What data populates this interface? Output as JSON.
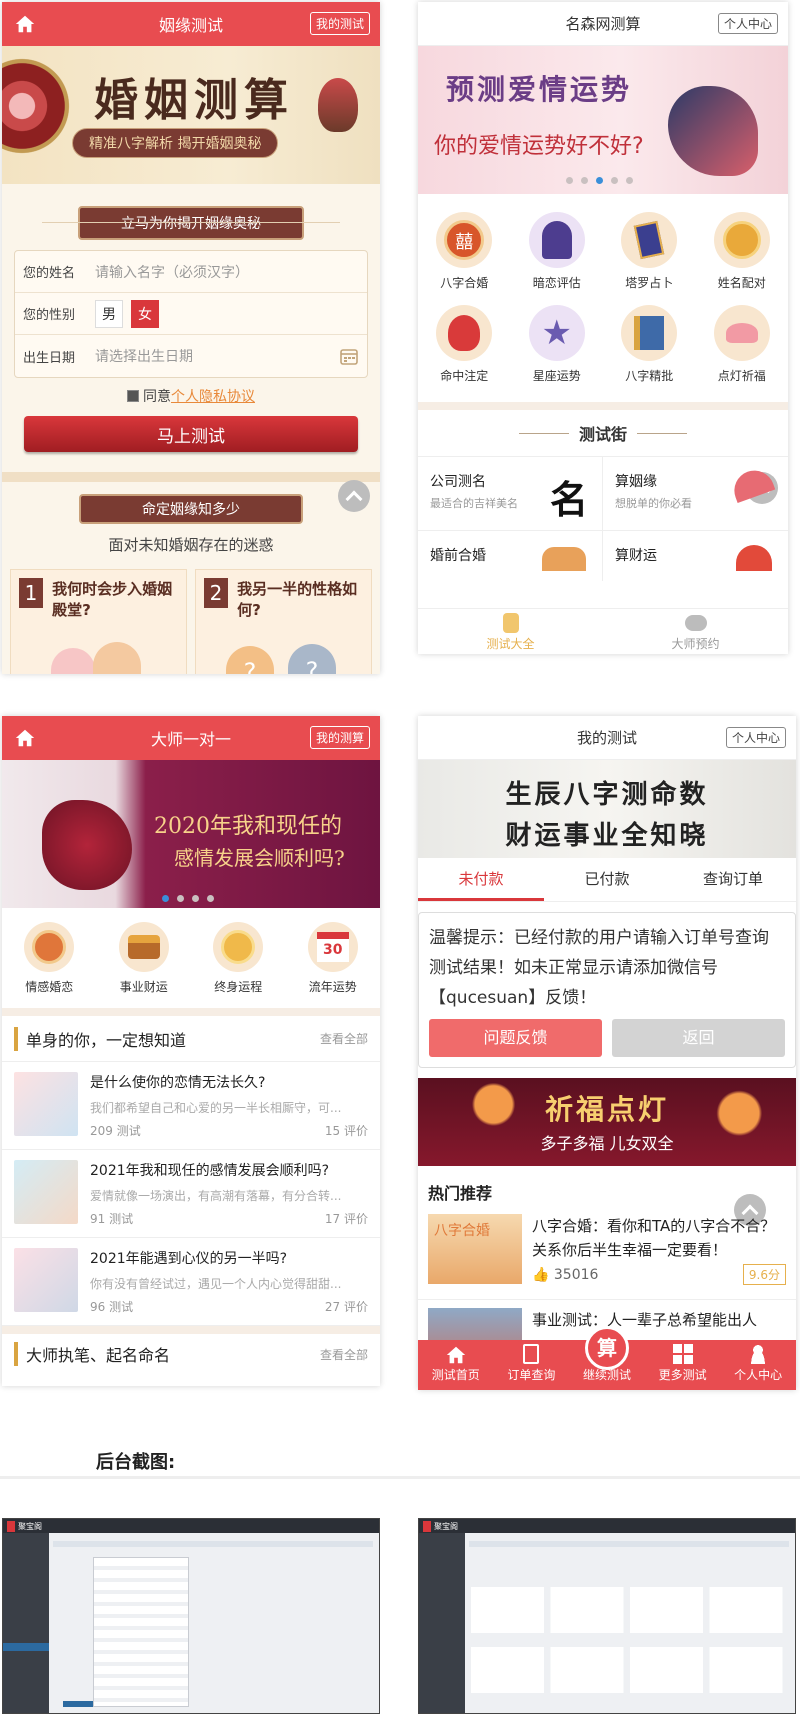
{
  "p1": {
    "title": "姻缘测试",
    "my_btn": "我的测试",
    "banner_title": "婚姻测算",
    "banner_sub": "精准八字解析  揭开婚姻奥秘",
    "ribbon": "立马为你揭开姻缘奥秘",
    "form": {
      "name_label": "您的姓名",
      "name_placeholder": "请输入名字（必须汉字）",
      "sex_label": "您的性别",
      "male": "男",
      "female": "女",
      "birth_label": "出生日期",
      "birth_placeholder": "请选择出生日期"
    },
    "agree_prefix": "同意",
    "agree_link": "个人隐私协议",
    "submit": "马上测试",
    "ribbon2": "命定姻缘知多少",
    "tagline": "面对未知婚姻存在的迷惑",
    "cards": [
      {
        "num": "1",
        "text": "我何时会步入婚姻殿堂?"
      },
      {
        "num": "2",
        "text": "我另一半的性格如何?"
      }
    ]
  },
  "p2": {
    "title": "名森网测算",
    "center_btn": "个人中心",
    "banner_title": "预测爱情运势",
    "banner_sub": "你的爱情运势好不好?",
    "icons": [
      {
        "label": "八字合婚",
        "icon": "double-happiness-icon"
      },
      {
        "label": "暗恋评估",
        "icon": "crush-icon"
      },
      {
        "label": "塔罗占卜",
        "icon": "tarot-icon"
      },
      {
        "label": "姓名配对",
        "icon": "coin-icon"
      },
      {
        "label": "命中注定",
        "icon": "fate-doll-icon"
      },
      {
        "label": "星座运势",
        "icon": "star-icon"
      },
      {
        "label": "八字精批",
        "icon": "book-icon"
      },
      {
        "label": "点灯祈福",
        "icon": "lantern-icon"
      }
    ],
    "section": "测试街",
    "street": [
      {
        "title": "公司测名",
        "sub": "最适合的吉祥美名"
      },
      {
        "title": "算姻缘",
        "sub": "想脱单的你必看"
      },
      {
        "title": "婚前合婚",
        "sub": ""
      },
      {
        "title": "算财运",
        "sub": ""
      }
    ],
    "tabs": [
      "测试大全",
      "大师预约"
    ],
    "colors": {
      "accent": "#e84c50",
      "tab_active": "#e6b04d"
    }
  },
  "p3": {
    "title": "大师一对一",
    "my_btn": "我的测算",
    "banner_title": "2020年我和现任的",
    "banner_sub": "感情发展会顺利吗?",
    "icons": [
      {
        "label": "情感婚恋"
      },
      {
        "label": "事业财运"
      },
      {
        "label": "终身运程"
      },
      {
        "label": "流年运势",
        "badge": "30"
      }
    ],
    "section1": "单身的你，一定想知道",
    "view_all": "查看全部",
    "list": [
      {
        "title": "是什么使你的恋情无法长久?",
        "desc": "我们都希望自己和心爱的另一半长相厮守，可...",
        "tests": "209 测试",
        "reviews": "15 评价"
      },
      {
        "title": "2021年我和现任的感情发展会顺利吗?",
        "desc": "爱情就像一场演出，有高潮有落幕，有分合转...",
        "tests": "91 测试",
        "reviews": "17 评价"
      },
      {
        "title": "2021年能遇到心仪的另一半吗?",
        "desc": "你有没有曾经试过，遇见一个人内心觉得甜甜...",
        "tests": "96 测试",
        "reviews": "27 评价"
      }
    ],
    "section2": "大师执笔、起名命名"
  },
  "p4": {
    "title": "我的测试",
    "center_btn": "个人中心",
    "banner_line1": "生辰八字测命数",
    "banner_line2": "财运事业全知晓",
    "tabs": [
      "未付款",
      "已付款",
      "查询订单"
    ],
    "notice": "温馨提示：已经付款的用户请输入订单号查询测试结果！如未正常显示请添加微信号【qucesuan】反馈！",
    "feedback_btn": "问题反馈",
    "back_btn": "返回",
    "banner2_title": "祈福点灯",
    "banner2_sub": "多子多福  儿女双全",
    "hot_title": "热门推荐",
    "hot": [
      {
        "img_text": "八字合婚",
        "title": "八字合婚：看你和TA的八字合不合？关系你后半生幸福一定要看！",
        "likes": "35016",
        "score": "9.6分"
      },
      {
        "title": "事业测试：人一辈子总希望能出人"
      }
    ],
    "bottom_tabs": [
      "测试首页",
      "订单查询",
      "继续测试",
      "更多测试",
      "个人中心"
    ],
    "center_tab_glyph": "算"
  },
  "backend": {
    "heading": "后台截图:",
    "logo": "聚宝阁"
  }
}
